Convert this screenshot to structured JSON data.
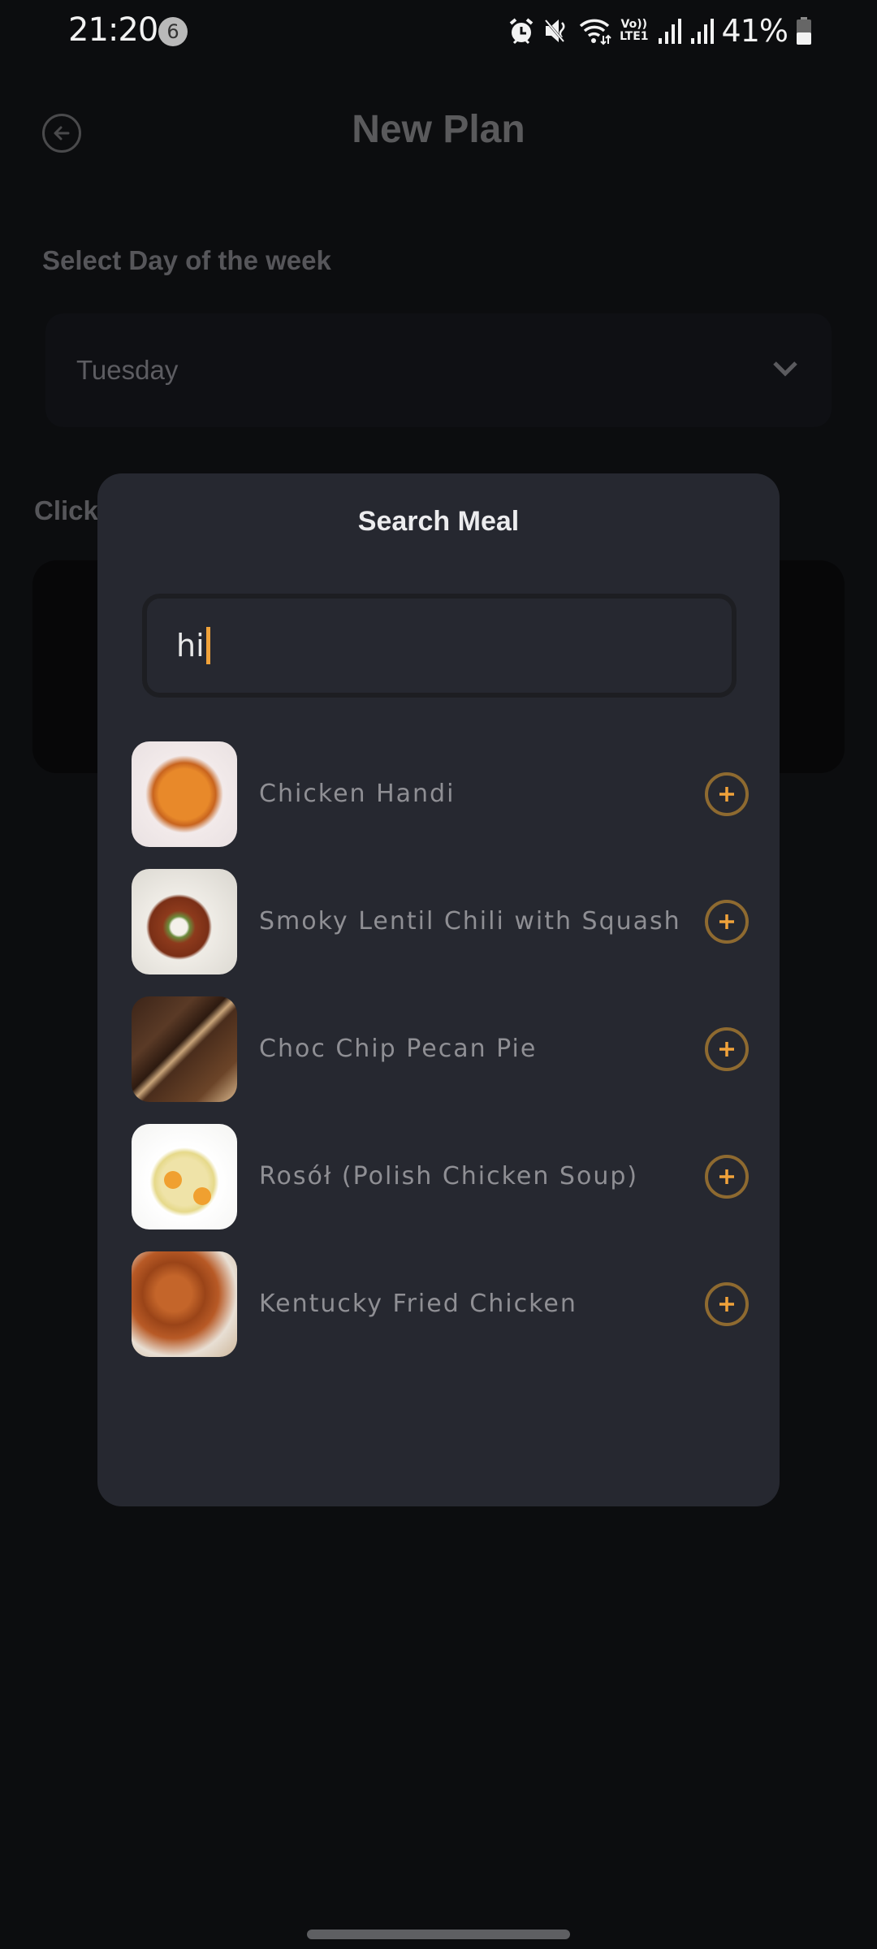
{
  "status_bar": {
    "time": "21:20",
    "notification_count": "6",
    "icons": [
      "alarm-icon",
      "mute-icon",
      "wifi-icon",
      "volte-lte-icon",
      "signal-icon",
      "signal-icon"
    ],
    "volte_label": "Vo))",
    "lte_label": "LTE1",
    "battery_percent": "41%"
  },
  "page": {
    "title": "New Plan",
    "back_icon": "arrow-left-circle-icon",
    "day_section_label": "Select Day of the week",
    "day_select": {
      "value": "Tuesday",
      "icon": "chevron-down-icon"
    },
    "click_label_partial": "Click"
  },
  "modal": {
    "title": "Search Meal",
    "search": {
      "value": "hi"
    },
    "results": [
      {
        "name": "Chicken Handi",
        "image": "chicken-handi",
        "action_icon": "plus-circle-icon"
      },
      {
        "name": "Smoky Lentil Chili with Squash",
        "image": "smoky-lentil-chili",
        "action_icon": "plus-circle-icon"
      },
      {
        "name": "Choc Chip Pecan Pie",
        "image": "choc-chip-pecan-pie",
        "action_icon": "plus-circle-icon"
      },
      {
        "name": "Rosół (Polish Chicken Soup)",
        "image": "polish-chicken-soup",
        "action_icon": "plus-circle-icon"
      },
      {
        "name": "Kentucky Fried Chicken",
        "image": "kentucky-fried-chicken",
        "action_icon": "plus-circle-icon"
      }
    ]
  },
  "colors": {
    "accent": "#f0a23a",
    "accent_ring": "#8e6a30",
    "modal_bg": "#262830",
    "screen_bg": "#0c0d0f"
  }
}
